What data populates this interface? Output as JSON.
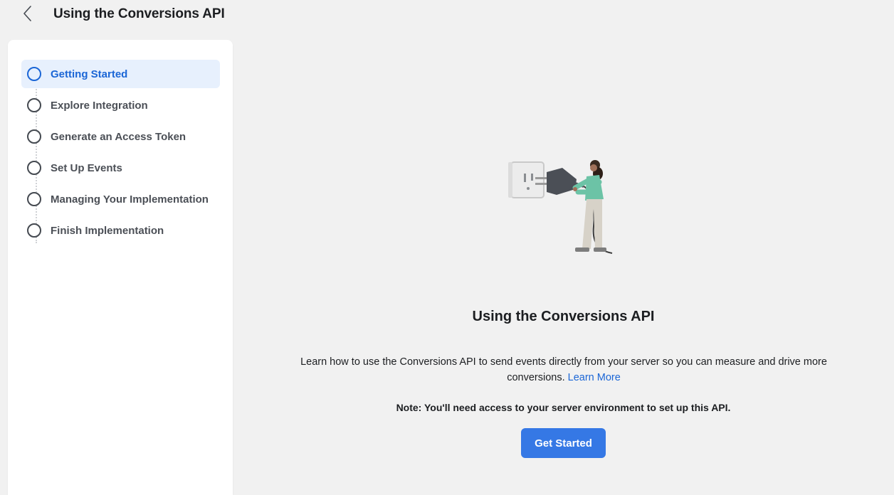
{
  "header": {
    "back_icon": "chevron-left-icon",
    "title": "Using the Conversions API"
  },
  "sidebar": {
    "steps": [
      {
        "label": "Getting Started",
        "active": true
      },
      {
        "label": "Explore Integration",
        "active": false
      },
      {
        "label": "Generate an Access Token",
        "active": false
      },
      {
        "label": "Set Up Events",
        "active": false
      },
      {
        "label": "Managing Your Implementation",
        "active": false
      },
      {
        "label": "Finish Implementation",
        "active": false
      }
    ]
  },
  "main": {
    "illustration": "person-plugging-cable-illustration",
    "title": "Using the Conversions API",
    "description": "Learn how to use the Conversions API to send events directly from your server so you can measure and drive more conversions.",
    "learn_more": "Learn More",
    "note": "Note: You'll need access to your server environment to set up this API.",
    "cta_label": "Get Started"
  },
  "colors": {
    "accent": "#3578e5",
    "active_text": "#1b66d6",
    "active_bg": "#e7f0fd",
    "page_bg": "#f1f1f1",
    "panel_bg": "#ffffff"
  }
}
